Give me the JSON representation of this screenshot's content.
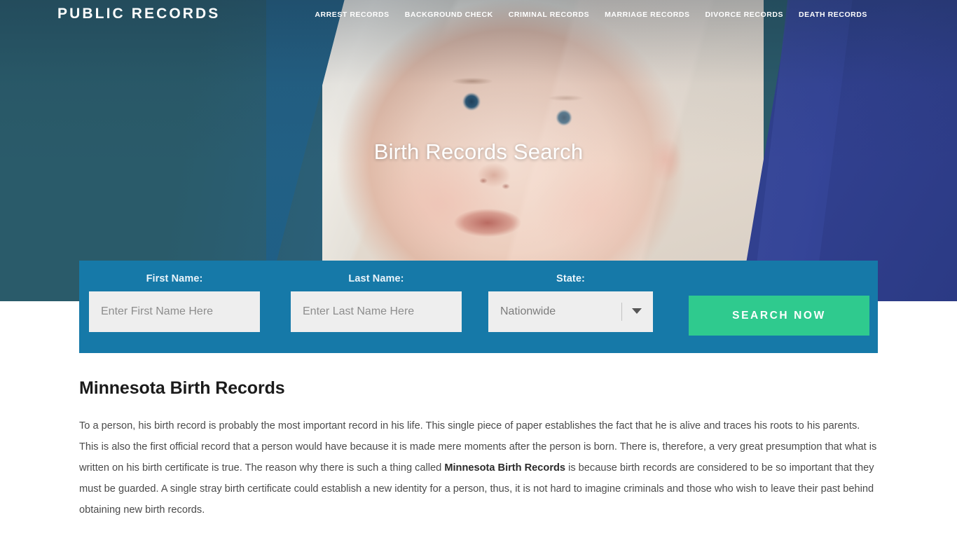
{
  "site": {
    "logo": "PUBLIC RECORDS",
    "accent_teal": "#2a5b6a",
    "accent_blue": "#2e3f8c",
    "panel_blue": "#1679a8",
    "button_green": "#2fca8e"
  },
  "nav": {
    "items": [
      {
        "label": "ARREST RECORDS"
      },
      {
        "label": "BACKGROUND CHECK"
      },
      {
        "label": "CRIMINAL RECORDS"
      },
      {
        "label": "MARRIAGE RECORDS"
      },
      {
        "label": "DIVORCE RECORDS"
      },
      {
        "label": "DEATH RECORDS"
      }
    ]
  },
  "hero": {
    "title": "Birth Records Search"
  },
  "search_form": {
    "first_name": {
      "label": "First Name:",
      "placeholder": "Enter First Name Here",
      "value": ""
    },
    "last_name": {
      "label": "Last Name:",
      "placeholder": "Enter Last Name Here",
      "value": ""
    },
    "state": {
      "label": "State:",
      "selected": "Nationwide"
    },
    "submit_label": "SEARCH NOW"
  },
  "main": {
    "heading": "Minnesota Birth Records",
    "paragraph_part1": "To a person, his birth record is probably the most important record in his life. This single piece of paper establishes the fact that he is alive and traces his roots to his parents. This is also the first official record that a person would have because it is made mere moments after the person is born. There is, therefore, a very great presumption that what is written on his birth certificate is true. The reason why there is such a thing called ",
    "paragraph_bold": "Minnesota Birth Records",
    "paragraph_part2": " is because birth records are considered to be so important that they must be guarded. A single stray birth certificate could establish a new identity for a person, thus, it is not hard to imagine criminals and those who wish to leave their past behind obtaining new birth records."
  }
}
